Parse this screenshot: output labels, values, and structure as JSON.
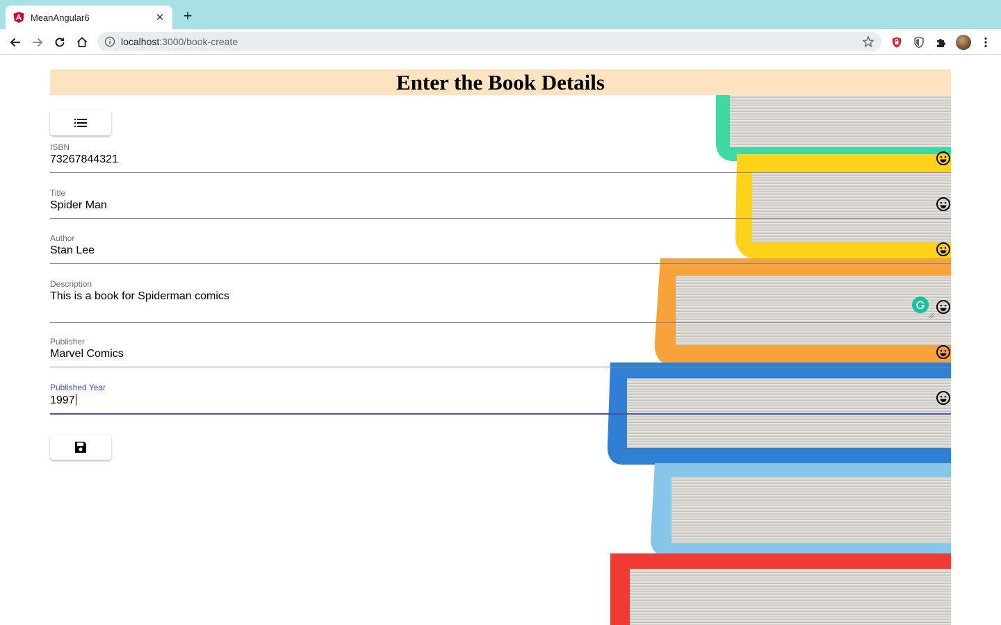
{
  "browser": {
    "tab_title": "MeanAngular6",
    "url_host": "localhost",
    "url_path": ":3000/book-create",
    "icons": [
      "angular-favicon",
      "close-icon",
      "plus-icon",
      "back-arrow-icon",
      "forward-arrow-icon",
      "reload-icon",
      "home-icon",
      "info-icon",
      "star-icon",
      "shield-extension-icon",
      "privacy-extension-icon",
      "puzzle-extensions-icon",
      "profile-avatar",
      "kebab-menu-icon"
    ]
  },
  "page": {
    "heading": "Enter the Book Details",
    "list_button_icon": "list-icon",
    "save_button_icon": "save-icon",
    "fields": {
      "isbn": {
        "label": "ISBN",
        "value": "73267844321"
      },
      "title": {
        "label": "Title",
        "value": "Spider Man"
      },
      "author": {
        "label": "Author",
        "value": "Stan Lee"
      },
      "description": {
        "label": "Description",
        "value": "This is a book for Spiderman comics"
      },
      "publisher": {
        "label": "Publisher",
        "value": "Marvel Comics"
      },
      "published_year": {
        "label": "Published Year",
        "value": "1997"
      }
    },
    "colors": {
      "banner": "#fde3c0",
      "active_field": "#3f51b5",
      "tab_strip": "#a8e1e5"
    }
  }
}
